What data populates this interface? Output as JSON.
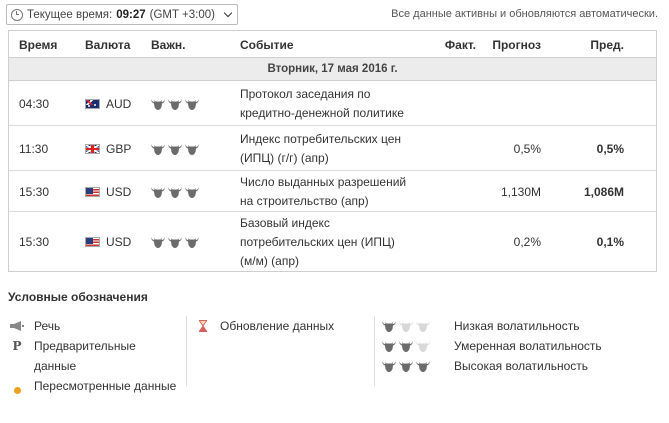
{
  "header": {
    "time_label": "Текущее время:",
    "time_value": "09:27",
    "tz": "(GMT +3:00)",
    "status": "Все данные активны и обновляются автоматически."
  },
  "table": {
    "columns": {
      "time": "Время",
      "currency": "Валюта",
      "importance": "Важн.",
      "event": "Событие",
      "actual": "Факт.",
      "forecast": "Прогноз",
      "previous": "Пред."
    },
    "date_label": "Вторник, 17 мая 2016 г.",
    "rows": [
      {
        "time": "04:30",
        "currency": "AUD",
        "flag": "australia-flag-icon",
        "importance": 3,
        "event_line1": "Протокол заседания по",
        "event_line2": "кредитно-денежной политике",
        "event_line3": "",
        "actual": "",
        "forecast": "",
        "previous": ""
      },
      {
        "time": "11:30",
        "currency": "GBP",
        "flag": "uk-flag-icon",
        "importance": 3,
        "event_line1": "Индекс потребительских цен",
        "event_line2": "(ИПЦ) (г/г) (апр)",
        "event_line3": "",
        "actual": "",
        "forecast": "0,5%",
        "previous": "0,5%"
      },
      {
        "time": "15:30",
        "currency": "USD",
        "flag": "us-flag-icon",
        "importance": 3,
        "event_line1": "Число выданных разрешений",
        "event_line2": "на строительство (апр)",
        "event_line3": "",
        "actual": "",
        "forecast": "1,130M",
        "previous": "1,086M"
      },
      {
        "time": "15:30",
        "currency": "USD",
        "flag": "us-flag-icon",
        "importance": 3,
        "event_line1": "Базовый индекс",
        "event_line2": "потребительских цен (ИПЦ)",
        "event_line3": "(м/м) (апр)",
        "actual": "",
        "forecast": "0,2%",
        "previous": "0,1%"
      }
    ]
  },
  "legend": {
    "title": "Условные обозначения",
    "speech": "Речь",
    "preliminary_line1": "Предварительные",
    "preliminary_line2": "данные",
    "revised": "Пересмотренные данные",
    "update": "Обновление данных",
    "low": "Низкая волатильность",
    "medium": "Умеренная волатильность",
    "high": "Высокая волатильность"
  },
  "colors": {
    "bull_active": "#6b6b6b",
    "bull_inactive": "#d8d8d8",
    "revised_dot": "#f0a020"
  }
}
